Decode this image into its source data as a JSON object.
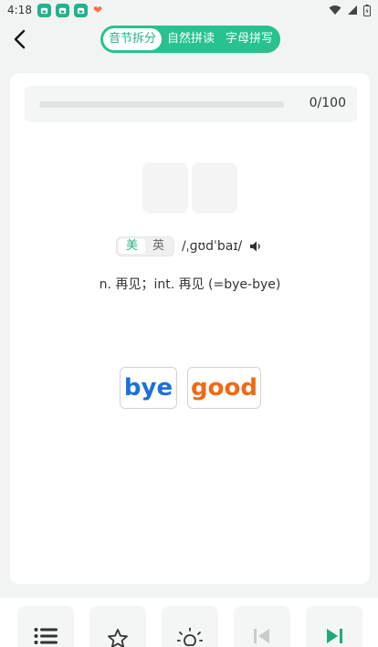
{
  "status_bar": {
    "time": "4:18"
  },
  "header": {
    "tabs": [
      {
        "label": "音节拆分",
        "active": true
      },
      {
        "label": "自然拼读",
        "active": false
      },
      {
        "label": "字母拼写",
        "active": false
      }
    ]
  },
  "progress": {
    "text": "0/100",
    "fraction": 0.0
  },
  "pronunciation": {
    "accents": [
      {
        "label": "美",
        "active": true
      },
      {
        "label": "英",
        "active": false
      }
    ],
    "phonetic": "/ˌɡʊdˈbaɪ/"
  },
  "definition": "n. 再见；int. 再见 (=bye-bye)",
  "choices": [
    {
      "label": "bye",
      "color": "#1e6fd9"
    },
    {
      "label": "good",
      "color": "#f06a14"
    }
  ],
  "colors": {
    "accent": "#27c290",
    "background": "#f2f4f3"
  },
  "toolbar": {
    "icons": [
      "list-icon",
      "star-icon",
      "lightbulb-icon",
      "skip-previous-icon",
      "skip-next-icon"
    ]
  }
}
